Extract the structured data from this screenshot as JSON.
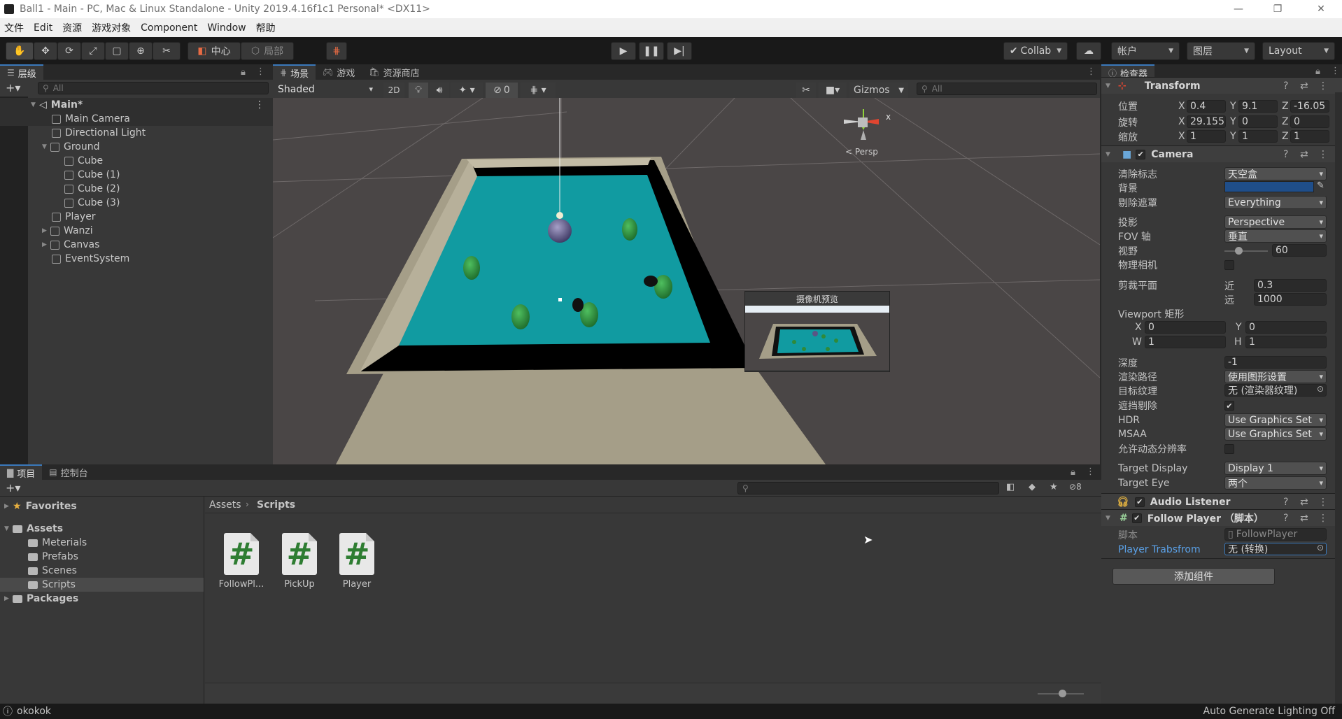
{
  "window": {
    "title": "Ball1 - Main - PC, Mac & Linux Standalone - Unity 2019.4.16f1c1 Personal* <DX11>"
  },
  "menu": [
    "文件",
    "Edit",
    "资源",
    "游戏对象",
    "Component",
    "Window",
    "帮助"
  ],
  "toolbar": {
    "pivot": "中心",
    "space": "局部",
    "collab": "Collab",
    "account": "帐户",
    "layers": "图层",
    "layout": "Layout"
  },
  "hierarchy": {
    "tab": "层级",
    "search_placeholder": "All",
    "scene": "Main*",
    "items": [
      {
        "label": "Main Camera"
      },
      {
        "label": "Directional Light"
      },
      {
        "label": "Ground"
      },
      {
        "label": "Cube"
      },
      {
        "label": "Cube (1)"
      },
      {
        "label": "Cube (2)"
      },
      {
        "label": "Cube (3)"
      },
      {
        "label": "Player"
      },
      {
        "label": "Wanzi"
      },
      {
        "label": "Canvas"
      },
      {
        "label": "EventSystem"
      }
    ]
  },
  "scene_tabs": [
    "场景",
    "游戏",
    "资源商店"
  ],
  "scene_toolbar": {
    "shading": "Shaded",
    "mode2d": "2D",
    "hidden_count": "0",
    "gizmos": "Gizmos",
    "search_placeholder": "All"
  },
  "gizmo": {
    "y": "y",
    "x": "x",
    "persp": "< Persp"
  },
  "camera_preview": {
    "title": "摄像机预览"
  },
  "inspector": {
    "tab": "检查器",
    "transform": {
      "title": "Transform",
      "position_label": "位置",
      "position": {
        "x": "0.4",
        "y": "9.1",
        "z": "-16.05"
      },
      "rotation_label": "旋转",
      "rotation": {
        "x": "29.155",
        "y": "0",
        "z": "0"
      },
      "scale_label": "缩放",
      "scale": {
        "x": "1",
        "y": "1",
        "z": "1"
      }
    },
    "camera": {
      "title": "Camera",
      "clear_flags_label": "清除标志",
      "clear_flags": "天空盒",
      "background_label": "背景",
      "background_color": "#1f4e8a",
      "culling_mask_label": "剔除遮罩",
      "culling_mask": "Everything",
      "projection_label": "投影",
      "projection": "Perspective",
      "fov_axis_label": "FOV 轴",
      "fov_axis": "垂直",
      "fov_label": "视野",
      "fov": "60",
      "fov_fraction": 0.33,
      "physical_label": "物理相机",
      "clipping_label": "剪裁平面",
      "near_label": "近",
      "near": "0.3",
      "far_label": "远",
      "far": "1000",
      "viewport_label": "Viewport 矩形",
      "vp": {
        "x": "0",
        "y": "0",
        "w": "1",
        "h": "1"
      },
      "depth_label": "深度",
      "depth": "-1",
      "render_path_label": "渲染路径",
      "render_path": "使用图形设置",
      "target_texture_label": "目标纹理",
      "target_texture": "无 (渲染器纹理)",
      "occlusion_label": "遮挡剔除",
      "hdr_label": "HDR",
      "hdr": "Use Graphics Set",
      "msaa_label": "MSAA",
      "msaa": "Use Graphics Set",
      "dynres_label": "允许动态分辨率",
      "target_display_label": "Target Display",
      "target_display": "Display 1",
      "target_eye_label": "Target Eye",
      "target_eye": "两个"
    },
    "audio_listener": {
      "title": "Audio Listener"
    },
    "follow_player": {
      "title": "Follow Player （脚本）",
      "script_label": "脚本",
      "script": "FollowPlayer",
      "field_label": "Player Trabsfrom",
      "field": "无 (转换)"
    },
    "add_component": "添加组件"
  },
  "project": {
    "tabs": [
      "项目",
      "控制台"
    ],
    "hidden_count": "8",
    "tree": {
      "favorites": "Favorites",
      "assets": "Assets",
      "folders": [
        "Meterials",
        "Prefabs",
        "Scenes",
        "Scripts"
      ],
      "packages": "Packages"
    },
    "breadcrumb": [
      "Assets",
      "Scripts"
    ],
    "assets": [
      {
        "name": "FollowPl..."
      },
      {
        "name": "PickUp"
      },
      {
        "name": "Player"
      }
    ]
  },
  "status": {
    "message": "okokok",
    "lighting": "Auto Generate Lighting Off"
  }
}
